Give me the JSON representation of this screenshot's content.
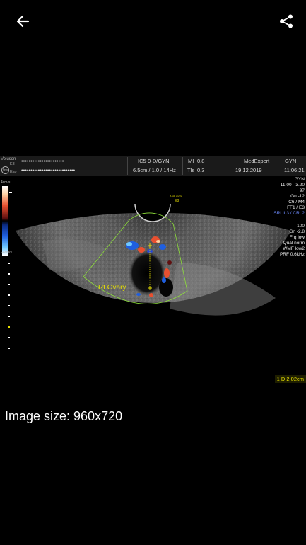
{
  "toolbar": {
    "back_icon": "arrow-left-icon",
    "share_icon": "share-icon"
  },
  "scan": {
    "brand": "Voluson",
    "probe_top": "E8",
    "probe_bottom": "Exp",
    "patient_masked": "•••••••••••••••••••••••",
    "id_masked": "•••••••••••••••••••••••••••••",
    "probe_mode": "IC5-9-D/GYN",
    "depth_freq": "6.5cm / 1.0 / 14Hz",
    "mi_label": "MI",
    "mi_value": "0.8",
    "tis_label": "TIs",
    "tis_value": "0.3",
    "clinic": "MedExpert",
    "date": "19.12.2019",
    "time": "11:06:21",
    "scale_top": "4cm/s",
    "scale_bottom": "-4cm/s",
    "apex_brand": "Voluson",
    "apex_model": "E8",
    "label_ovary": "Rt Ovary",
    "params": [
      "GYN",
      "11.00 - 3.20",
      "97",
      "Gn -12",
      "C6 / M4",
      "FF1 / E3"
    ],
    "param_highlight": "SRI II 3 / CRI 2",
    "color_params": [
      "100",
      "Gn -2.8",
      "Frq low",
      "Qual norm",
      "WMF low2",
      "PRF  0.6kHz"
    ],
    "measure_index": "1",
    "measure_value": "D 2.02cm"
  },
  "image_info": {
    "label": "Image size: 960x720"
  },
  "colors": {
    "background": "#000000",
    "annotation": "#e8e000",
    "doppler_blue": "#1f5fe0",
    "doppler_red": "#e85030",
    "sector_outline": "#8ee03a"
  }
}
